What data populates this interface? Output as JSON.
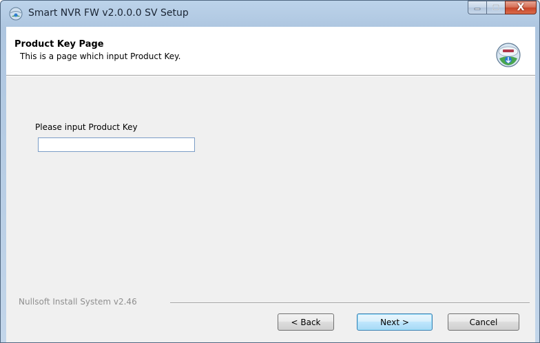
{
  "window": {
    "title": "Smart NVR FW v2.0.0.0 SV Setup",
    "minimize_label": "–",
    "maximize_label": "□",
    "close_label": "X"
  },
  "header": {
    "title": "Product Key Page",
    "subtitle": "This is a page which input Product Key."
  },
  "main": {
    "prompt_label": "Please input Product Key",
    "product_key_value": "",
    "product_key_placeholder": ""
  },
  "footer": {
    "branding": "Nullsoft Install System v2.46",
    "back_label": "< Back",
    "next_label": "Next >",
    "cancel_label": "Cancel"
  },
  "icons": {
    "title_icon": "installer-globe-icon",
    "header_icon": "installer-globe-icon"
  },
  "colors": {
    "frame": "#bcd3ea",
    "close_button": "#c7452a",
    "header_bg": "#ffffff",
    "client_bg": "#f0f0f0",
    "input_border": "#7a9cc6",
    "default_button_border": "#3c7fb1"
  }
}
